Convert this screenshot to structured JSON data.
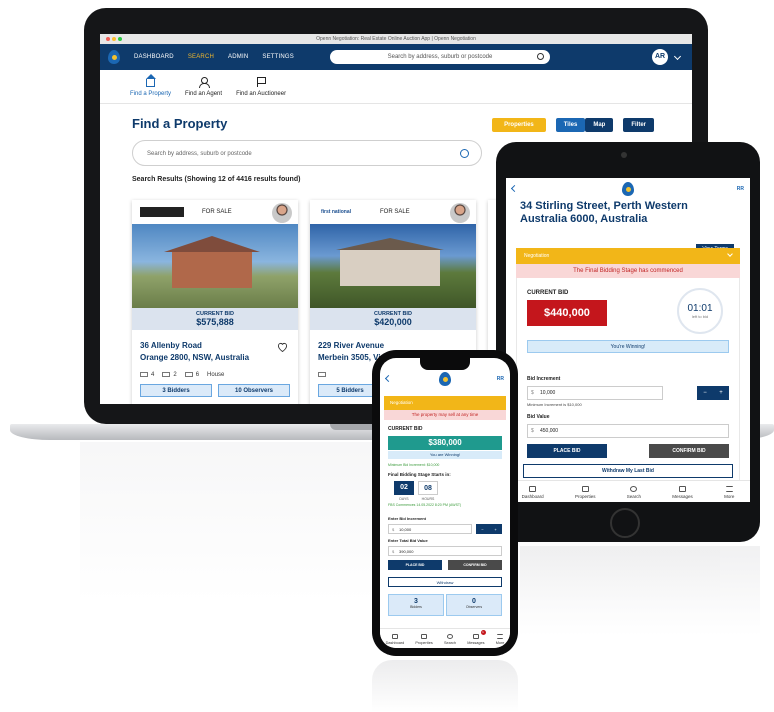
{
  "laptop": {
    "window_title": "Openn Negotiation: Real Estate Online Auction App | Openn Negotiation",
    "nav": [
      "DASHBOARD",
      "SEARCH",
      "ADMIN",
      "SETTINGS"
    ],
    "nav_active": "SEARCH",
    "nav_search_placeholder": "Search by address, suburb or postcode",
    "avatar_initials": "AR",
    "subnav": [
      "Find a Property",
      "Find an Agent",
      "Find an Auctioneer"
    ],
    "page_title": "Find a Property",
    "buttons": {
      "properties": "Properties",
      "tiles": "Tiles",
      "map": "Map",
      "filter": "Filter"
    },
    "search_placeholder": "Search by address, suburb or postcode",
    "results_text": "Search Results (Showing 12 of 4416 results found)",
    "cards": [
      {
        "status": "FOR SALE",
        "bid_label": "CURRENT BID",
        "bid": "$575,888",
        "address_line1": "36 Allenby Road",
        "address_line2": "Orange 2800, NSW, Australia",
        "beds": "4",
        "baths": "2",
        "cars": "6",
        "type": "House",
        "bidders": "3 Bidders",
        "observers": "10 Observers"
      },
      {
        "agency": "first national",
        "status": "FOR SALE",
        "bid_label": "CURRENT BID",
        "bid": "$420,000",
        "address_line1": "229 River Avenue",
        "address_line2": "Merbein 3505, Vic",
        "bidders": "5 Bidders"
      }
    ]
  },
  "tablet": {
    "initials": "RR",
    "address": "34 Stirling Street, Perth Western Australia 6000, Australia",
    "view_terms": "View Terms",
    "negotiation": "Negotiation",
    "alert": "The Final Bidding Stage has commenced",
    "current_bid_label": "CURRENT BID",
    "current_bid": "$440,000",
    "timer": "01:01",
    "timer_label": "left to bid",
    "winning": "You're Winning!",
    "bid_increment_label": "Bid Increment",
    "bid_increment": "10,000",
    "min_increment": "Minimum Increment is $10,000",
    "bid_value_label": "Bid Value",
    "bid_value": "450,000",
    "place_bid": "PLACE BID",
    "confirm_bid": "CONFIRM BID",
    "withdraw": "Withdraw My Last Bid",
    "tabs": [
      "Dashboard",
      "Properties",
      "Search",
      "Messages",
      "More"
    ]
  },
  "phone": {
    "initials": "RR",
    "negotiation": "Negotiation",
    "alert": "The property may sell at any time",
    "current_bid_label": "CURRENT BID",
    "current_bid": "$380,000",
    "winning": "You are Winning!",
    "min_increment": "Minimum Bid Increment: $10,000",
    "final_stage": "Final Bidding Stage Starts in:",
    "days": "02",
    "days_label": "DAYS",
    "hours": "08",
    "hours_label": "HOURS",
    "date_text": "FBS Commences 14.05.2022 8:20 PM (AWST)",
    "enter_increment_label": "Enter Bid Increment",
    "increment": "10,000",
    "enter_total_label": "Enter Total Bid Value",
    "total": "390,000",
    "place_bid": "PLACE BID",
    "confirm_bid": "CONFIRM BID",
    "withdraw": "Withdraw",
    "bidders_n": "3",
    "bidders_t": "Bidders",
    "observers_n": "0",
    "observers_t": "Observers",
    "tabs": [
      "Dashboard",
      "Properties",
      "Search",
      "Messages",
      "More"
    ],
    "messages_badge": "1"
  },
  "colors": {
    "navy": "#0e3a6b",
    "blue": "#1b67b3",
    "yellow": "#f2b618",
    "red": "#c4161c",
    "teal": "#1f9a8e"
  }
}
